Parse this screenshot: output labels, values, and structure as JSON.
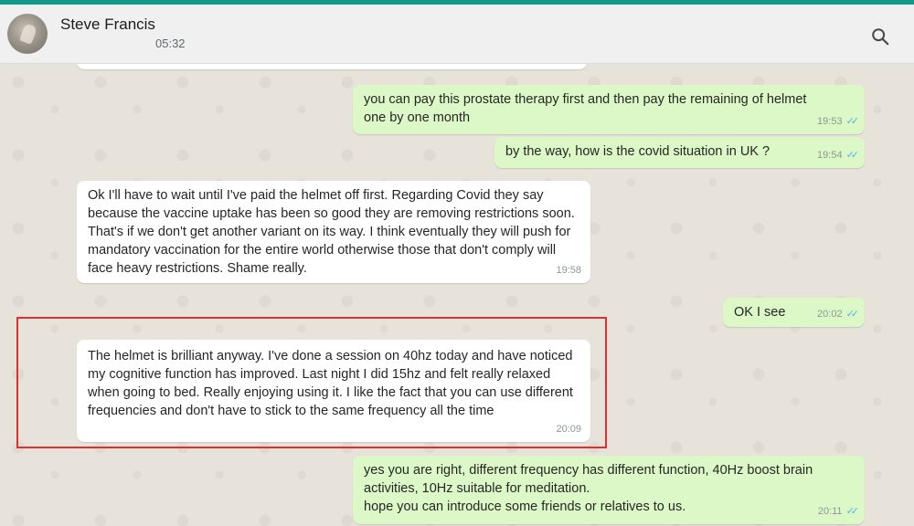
{
  "header": {
    "contact_name": "Steve Francis",
    "last_seen": "05:32"
  },
  "messages": [
    {
      "dir": "out",
      "text": "you can pay this prostate therapy first and then pay the remaining of helmet one by one month",
      "time": "19:53"
    },
    {
      "dir": "out",
      "text": "by the way, how is the covid situation in UK ?",
      "time": "19:54"
    },
    {
      "dir": "in",
      "text": "Ok I'll have to wait until I've paid the helmet off first. Regarding Covid they say because the vaccine uptake has been so good they are removing restrictions soon. That's if we don't get another variant on its way. I think eventually they will push for mandatory vaccination for the entire world otherwise those that don't comply will face heavy restrictions. Shame really.",
      "time": "19:58"
    },
    {
      "dir": "out",
      "text": "OK I see",
      "time": "20:02"
    },
    {
      "dir": "in",
      "text": "The helmet is brilliant anyway. I've done a session on 40hz today and have noticed my cognitive function has improved. Last night I did 15hz and felt really relaxed when going to bed. Really enjoying using it. I like the fact that you can use different frequencies and don't have to stick to the same frequency all the time",
      "time": "20:09"
    },
    {
      "dir": "out",
      "text": "yes you are right, different frequency has different function, 40Hz boost brain activities, 10Hz suitable for meditation.\nhope you can introduce some friends or relatives to us.",
      "time": "20:11"
    }
  ],
  "colors": {
    "accent": "#0f9b87",
    "incoming_bubble": "#ffffff",
    "outgoing_bubble": "#dcf8c6",
    "read_ticks": "#4fb6ec",
    "highlight_box": "#e02f2f"
  },
  "icons": {
    "search": "search-icon",
    "read_receipt": "double-check-icon"
  }
}
